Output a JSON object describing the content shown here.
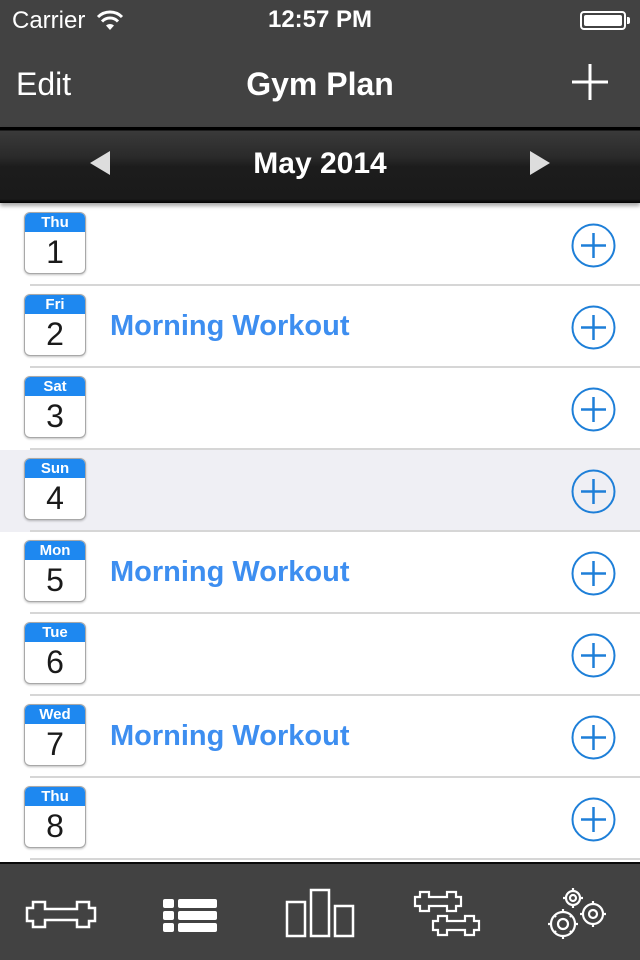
{
  "status_bar": {
    "carrier": "Carrier",
    "time": "12:57 PM",
    "icons": [
      "wifi-icon",
      "battery-icon"
    ]
  },
  "nav_bar": {
    "edit_label": "Edit",
    "title": "Gym Plan",
    "add_icon": "plus-icon"
  },
  "month_bar": {
    "label": "May 2014",
    "prev_icon": "triangle-left-icon",
    "next_icon": "triangle-right-icon"
  },
  "colors": {
    "accent": "#1e88f0",
    "workout_text": "#3d8ef0",
    "bar_background": "#424242",
    "selected_row": "#efeff4"
  },
  "days": [
    {
      "dow": "Thu",
      "day": "1",
      "workout": "",
      "selected": false
    },
    {
      "dow": "Fri",
      "day": "2",
      "workout": "Morning Workout",
      "selected": false
    },
    {
      "dow": "Sat",
      "day": "3",
      "workout": "",
      "selected": false
    },
    {
      "dow": "Sun",
      "day": "4",
      "workout": "",
      "selected": true
    },
    {
      "dow": "Mon",
      "day": "5",
      "workout": "Morning Workout",
      "selected": false
    },
    {
      "dow": "Tue",
      "day": "6",
      "workout": "",
      "selected": false
    },
    {
      "dow": "Wed",
      "day": "7",
      "workout": "Morning Workout",
      "selected": false
    },
    {
      "dow": "Thu",
      "day": "8",
      "workout": "",
      "selected": false
    }
  ],
  "tab_bar": {
    "tabs": [
      {
        "icon": "dumbbell-icon"
      },
      {
        "icon": "list-icon"
      },
      {
        "icon": "bar-chart-icon"
      },
      {
        "icon": "two-dumbbells-icon"
      },
      {
        "icon": "gears-icon"
      }
    ]
  }
}
